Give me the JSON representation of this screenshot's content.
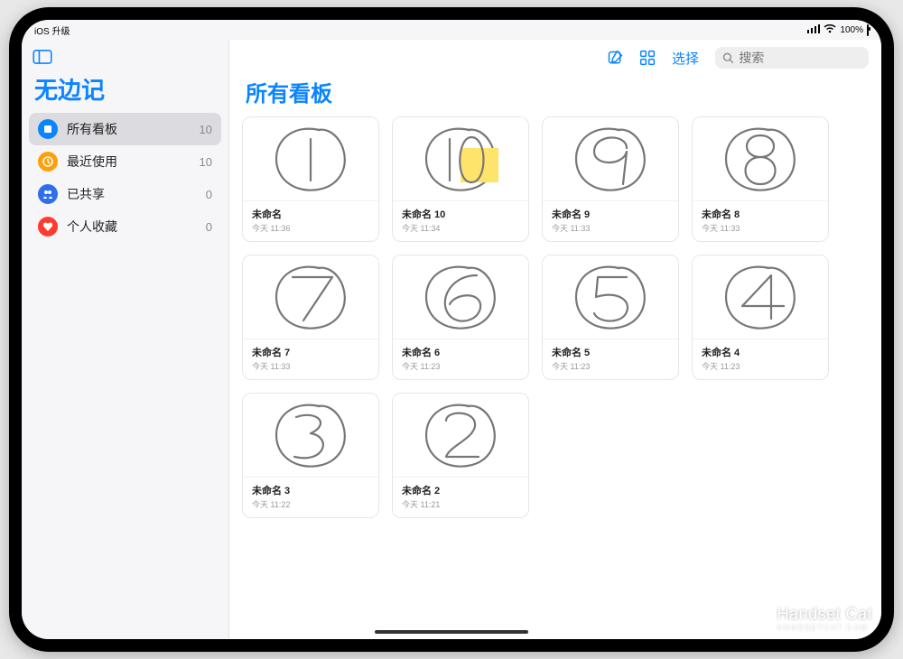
{
  "status": {
    "left": "iOS 升级",
    "signal": "•••",
    "wifi": true,
    "battery_text": "100%"
  },
  "app_title": "无边记",
  "sidebar": {
    "items": [
      {
        "id": "all",
        "label": "所有看板",
        "count": "10",
        "color": "#0a84ff",
        "icon": "boards",
        "selected": true
      },
      {
        "id": "recent",
        "label": "最近使用",
        "count": "10",
        "color": "#ff9f0a",
        "icon": "clock",
        "selected": false
      },
      {
        "id": "shared",
        "label": "已共享",
        "count": "0",
        "color": "#2f6fec",
        "icon": "people",
        "selected": false
      },
      {
        "id": "favorite",
        "label": "个人收藏",
        "count": "0",
        "color": "#ff3b30",
        "icon": "heart",
        "selected": false
      }
    ]
  },
  "toolbar": {
    "new_label": "新建",
    "layout_label": "布局",
    "select_label": "选择"
  },
  "search": {
    "placeholder": "搜索"
  },
  "main_title": "所有看板",
  "boards": [
    {
      "title": "未命名",
      "time": "今天 11:36",
      "glyph": "1",
      "sticky": false
    },
    {
      "title": "未命名 10",
      "time": "今天 11:34",
      "glyph": "10",
      "sticky": true
    },
    {
      "title": "未命名 9",
      "time": "今天 11:33",
      "glyph": "9",
      "sticky": false
    },
    {
      "title": "未命名 8",
      "time": "今天 11:33",
      "glyph": "8",
      "sticky": false
    },
    {
      "title": "未命名 7",
      "time": "今天 11:33",
      "glyph": "7",
      "sticky": false
    },
    {
      "title": "未命名 6",
      "time": "今天 11:23",
      "glyph": "6",
      "sticky": false
    },
    {
      "title": "未命名 5",
      "time": "今天 11:23",
      "glyph": "5",
      "sticky": false
    },
    {
      "title": "未命名 4",
      "time": "今天 11:23",
      "glyph": "4",
      "sticky": false
    },
    {
      "title": "未命名 3",
      "time": "今天 11:22",
      "glyph": "3",
      "sticky": false
    },
    {
      "title": "未命名 2",
      "time": "今天 11:21",
      "glyph": "2",
      "sticky": false
    }
  ],
  "watermark": {
    "brand": "Handset Cat",
    "sub": "HANDSETCAT.COM"
  }
}
